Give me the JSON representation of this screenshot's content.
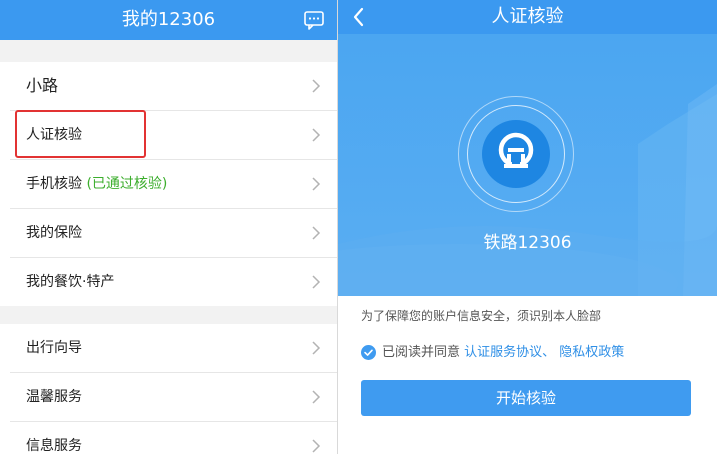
{
  "left": {
    "title": "我的12306",
    "group1": [
      {
        "label": "小路",
        "big": true
      },
      {
        "label": "人证核验"
      },
      {
        "label": "手机核验",
        "suffix": "(已通过核验)"
      },
      {
        "label": "我的保险"
      },
      {
        "label": "我的餐饮·特产"
      }
    ],
    "group2": [
      {
        "label": "出行向导"
      },
      {
        "label": "温馨服务"
      },
      {
        "label": "信息服务"
      }
    ]
  },
  "right": {
    "title": "人证核验",
    "brand": "铁路12306",
    "notice": "为了保障您的账户信息安全，须识别本人脸部",
    "agree_prefix": "已阅读并同意",
    "agree_links": "认证服务协议、 隐私权政策",
    "start_button": "开始核验",
    "agree_checked": true
  },
  "colors": {
    "header_blue": "#3b99f0",
    "hero_blue": "#4aa5f0",
    "verified_green": "#3cae2d",
    "highlight_red": "#e23333",
    "link_blue": "#2f8fe6"
  },
  "icons": {
    "message": "message-icon",
    "chevron": "chevron-right-icon",
    "back": "back-arrow-icon",
    "logo": "railway-logo-icon",
    "check": "check-circle-icon"
  }
}
